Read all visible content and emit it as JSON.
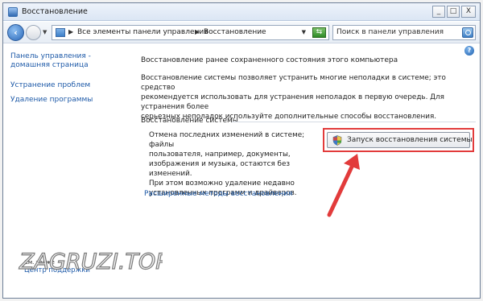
{
  "window": {
    "title": "Восстановление",
    "controls": {
      "minimize": "_",
      "maximize": "□",
      "close": "X"
    }
  },
  "addressbar": {
    "back_icon": "back-arrow-icon",
    "forward_icon": "forward-arrow-icon",
    "breadcrumb": [
      "Все элементы панели управления",
      "Восстановление"
    ],
    "refresh_icon": "refresh-icon",
    "search_placeholder": "Поиск в панели управления"
  },
  "sidebar": {
    "items": [
      {
        "label_line1": "Панель управления -",
        "label_line2": "домашняя страница"
      },
      {
        "label": "Устранение проблем"
      },
      {
        "label": "Удаление программы"
      }
    ],
    "see_also": "См. также",
    "support": "Центр поддержки"
  },
  "main": {
    "heading": "Восстановление ранее сохраненного состояния этого компьютера",
    "paragraph_lines": [
      "Восстановление системы позволяет устранить многие неполадки в системе; это средство",
      "рекомендуется использовать для устранения неполадок в первую очередь. Для устранения более",
      "серьезных неполадок используйте дополнительные способы восстановления."
    ],
    "section_title": "Восстановление системы",
    "section_desc_lines": [
      "Отмена последних изменений в системе; файлы",
      "пользователя, например, документы,",
      "изображения и музыка, остаются без изменений.",
      "При этом возможно удаление недавно",
      "установленных программ и драйверов."
    ],
    "restore_button": "Запуск восстановления системы",
    "advanced_link": "Расширенные методы восстановления",
    "help_icon": "?"
  },
  "watermark": "ZAGRUZI.TOP",
  "colors": {
    "link": "#1e5aa8",
    "annotation": "#e23b3b",
    "frame": "#6d7f97"
  }
}
